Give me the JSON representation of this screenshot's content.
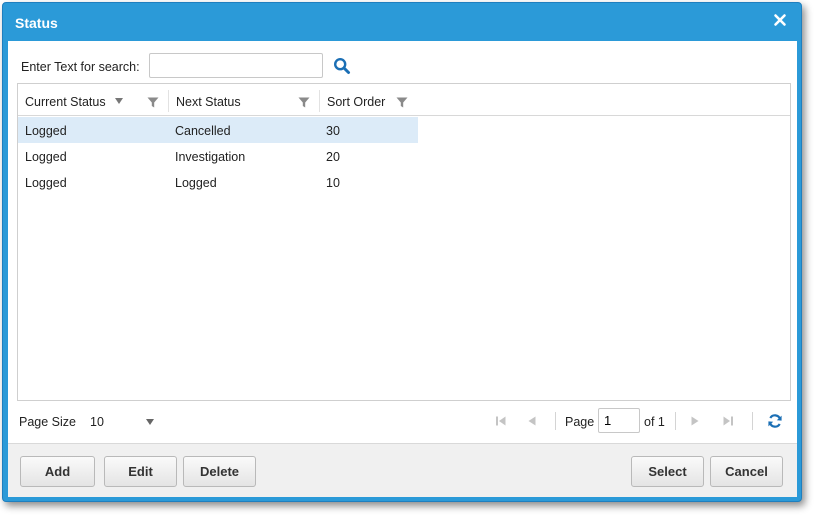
{
  "dialog": {
    "title": "Status"
  },
  "search": {
    "label": "Enter Text for search:",
    "value": "",
    "placeholder": ""
  },
  "grid": {
    "columns": [
      "Current Status",
      "Next Status",
      "Sort Order"
    ],
    "rows": [
      {
        "current_status": "Logged",
        "next_status": "Cancelled",
        "sort_order": "30",
        "selected": true
      },
      {
        "current_status": "Logged",
        "next_status": "Investigation",
        "sort_order": "20",
        "selected": false
      },
      {
        "current_status": "Logged",
        "next_status": "Logged",
        "sort_order": "10",
        "selected": false
      }
    ]
  },
  "pager": {
    "page_size_label": "Page Size",
    "page_size_value": "10",
    "page_label": "Page",
    "page_value": "1",
    "of_label": "of 1"
  },
  "footer": {
    "add_label": "Add",
    "edit_label": "Edit",
    "delete_label": "Delete",
    "select_label": "Select",
    "cancel_label": "Cancel"
  },
  "colors": {
    "titlebar": "#2b9ad8",
    "selected_row": "#dcebf8",
    "accent_icon": "#1b6fb5"
  },
  "icons": [
    "close-icon",
    "search-icon",
    "sort-desc-icon",
    "filter-icon",
    "first-page-icon",
    "prev-page-icon",
    "next-page-icon",
    "last-page-icon",
    "refresh-icon",
    "chevron-down-icon"
  ]
}
